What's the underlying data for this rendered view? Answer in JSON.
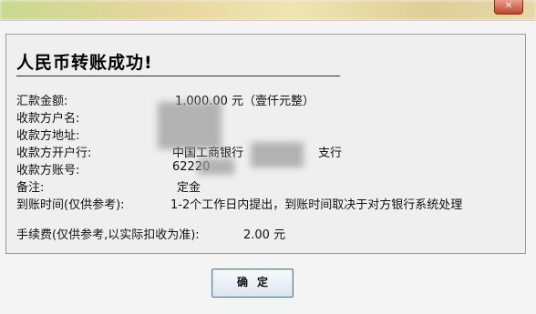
{
  "window": {
    "close_label": "✕"
  },
  "dialog": {
    "heading": "人民币转账成功!",
    "fields": {
      "amount": {
        "label": "汇款金额:",
        "value": "1,000.00 元（壹仟元整）"
      },
      "payee": {
        "label": "收款方户名:",
        "value": ""
      },
      "address": {
        "label": "收款方地址:",
        "value": ""
      },
      "bank": {
        "label": "收款方开户行:",
        "value_visible": "中国工商银行",
        "value_suffix": "支行"
      },
      "account": {
        "label": "收款方账号:",
        "value_visible": "62220"
      },
      "note": {
        "label": "备注:",
        "value": "定金"
      },
      "arrival": {
        "label": "到账时间(仅供参考):",
        "value": "1-2个工作日内提出，到账时间取决于对方银行系统处理"
      },
      "fee": {
        "label": "手续费(仅供参考,以实际扣收为准):",
        "value": "2.00 元"
      }
    },
    "ok_button": "确定"
  }
}
